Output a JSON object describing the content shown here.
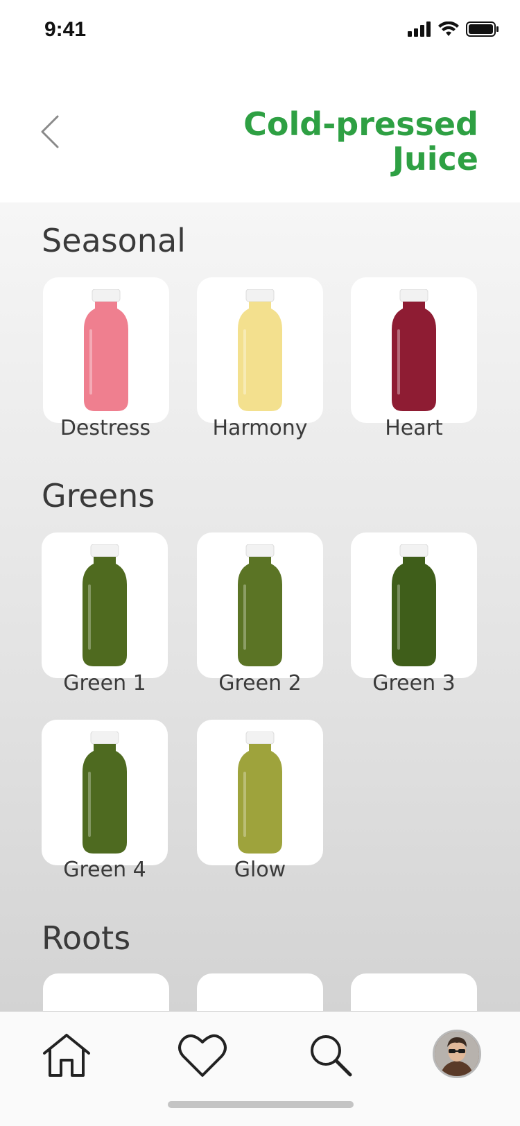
{
  "status": {
    "time": "9:41"
  },
  "header": {
    "title": "Cold-pressed Juice"
  },
  "sections": [
    {
      "title": "Seasonal",
      "items": [
        {
          "label": "Destress",
          "color": "#ef7f8f"
        },
        {
          "label": "Harmony",
          "color": "#f3e08e"
        },
        {
          "label": "Heart",
          "color": "#8e1c33"
        }
      ]
    },
    {
      "title": "Greens",
      "items": [
        {
          "label": "Green 1",
          "color": "#4f6a1f"
        },
        {
          "label": "Green 2",
          "color": "#5b7425"
        },
        {
          "label": "Green 3",
          "color": "#3f5e1a"
        },
        {
          "label": "Green 4",
          "color": "#4e6a20"
        },
        {
          "label": "Glow",
          "color": "#9ea33c"
        }
      ]
    },
    {
      "title": "Roots",
      "items": [
        {
          "color": "#ef7f8f"
        },
        {
          "color": "#f3e08e"
        },
        {
          "color": "#8e1c33"
        }
      ]
    }
  ],
  "tabbar": {
    "icons": [
      "home-icon",
      "heart-icon",
      "search-icon",
      "avatar"
    ]
  },
  "colors": {
    "accent": "#2ea043"
  }
}
